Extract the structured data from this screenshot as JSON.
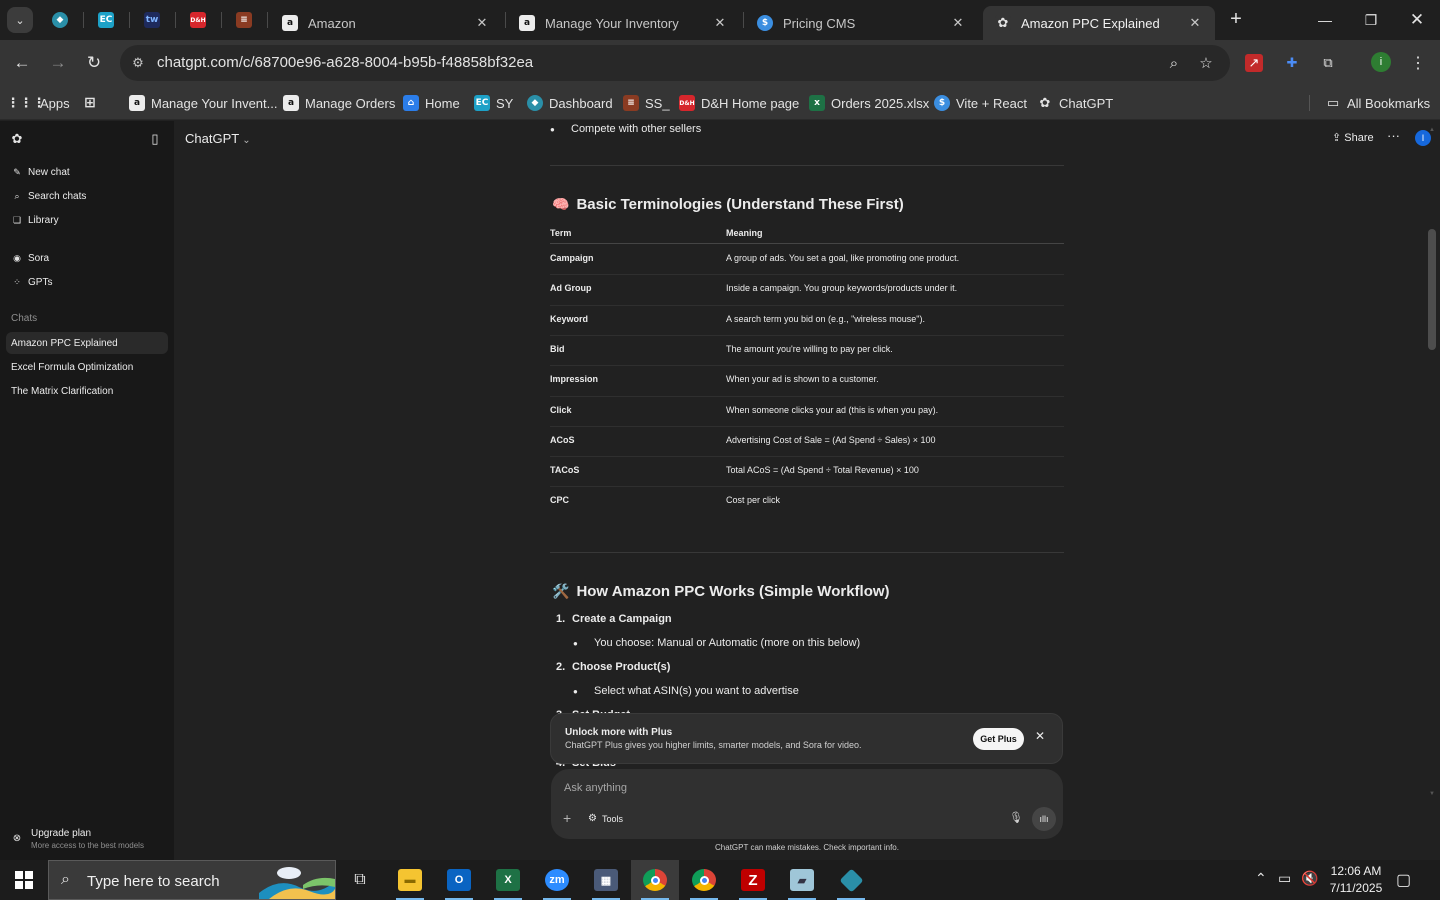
{
  "browser": {
    "tabs": [
      {
        "label": "Amazon",
        "icon": "amazon-icon"
      },
      {
        "label": "Manage Your Inventory",
        "icon": "amazon-icon"
      },
      {
        "label": "Pricing CMS",
        "icon": "dollar-icon"
      },
      {
        "label": "Amazon PPC Explained",
        "icon": "chatgpt-icon",
        "active": true
      }
    ],
    "pinned_tab_icons": [
      "sparkle-icon",
      "ec-icon",
      "tw-icon",
      "dh-icon",
      "stack-icon"
    ],
    "url": "chatgpt.com/c/68700e96-a628-8004-b95b-f48858bf32ea",
    "bookmarks": [
      {
        "label": "Apps",
        "icon": "apps-grid-icon"
      },
      {
        "label": "",
        "icon": "tab-groups-icon"
      },
      {
        "label": "Manage Your Invent...",
        "icon": "amazon-icon"
      },
      {
        "label": "Manage Orders",
        "icon": "amazon-icon"
      },
      {
        "label": "Home",
        "icon": "home-icon"
      },
      {
        "label": "SY",
        "icon": "ec-icon"
      },
      {
        "label": "Dashboard",
        "icon": "sparkle-icon"
      },
      {
        "label": "SS_",
        "icon": "stack-icon"
      },
      {
        "label": "D&H Home page",
        "icon": "dh-icon"
      },
      {
        "label": "Orders 2025.xlsx",
        "icon": "excel-icon"
      },
      {
        "label": "Vite + React",
        "icon": "dollar-icon"
      },
      {
        "label": "ChatGPT",
        "icon": "chatgpt-icon"
      }
    ],
    "all_bookmarks": "All Bookmarks",
    "colors": {
      "tabbar": "#1f1f1f",
      "toolbar": "#353535",
      "omnibox": "#282828"
    }
  },
  "sidebar": {
    "new_chat": "New chat",
    "search_chats": "Search chats",
    "library": "Library",
    "sora": "Sora",
    "gpts": "GPTs",
    "chats_heading": "Chats",
    "chats": [
      "Amazon PPC Explained",
      "Excel Formula Optimization",
      "The Matrix Clarification"
    ],
    "upgrade_title": "Upgrade plan",
    "upgrade_subtitle": "More access to the best models"
  },
  "header": {
    "model": "ChatGPT",
    "share": "Share",
    "avatar_initial": "I"
  },
  "content": {
    "prev_bullet": "Compete with other sellers",
    "section1_emoji": "🧠",
    "section1_title": "Basic Terminologies (Understand These First)",
    "table_headers": [
      "Term",
      "Meaning"
    ],
    "table_rows": [
      [
        "Campaign",
        "A group of ads. You set a goal, like promoting one product."
      ],
      [
        "Ad Group",
        "Inside a campaign. You group keywords/products under it."
      ],
      [
        "Keyword",
        "A search term you bid on (e.g., \"wireless mouse\")."
      ],
      [
        "Bid",
        "The amount you're willing to pay per click."
      ],
      [
        "Impression",
        "When your ad is shown to a customer."
      ],
      [
        "Click",
        "When someone clicks your ad (this is when you pay)."
      ],
      [
        "ACoS",
        "Advertising Cost of Sale = (Ad Spend ÷ Sales) × 100"
      ],
      [
        "TACoS",
        "Total ACoS = (Ad Spend ÷ Total Revenue) × 100"
      ],
      [
        "CPC",
        "Cost per click"
      ]
    ],
    "section2_emoji": "🛠️",
    "section2_title": "How Amazon PPC Works (Simple Workflow)",
    "steps": [
      {
        "n": "1.",
        "title": "Create a Campaign",
        "sub": "You choose: Manual or Automatic (more on this below)"
      },
      {
        "n": "2.",
        "title": "Choose Product(s)",
        "sub": "Select what ASIN(s) you want to advertise"
      },
      {
        "n": "3.",
        "title": "Set Budget"
      },
      {
        "n": "4.",
        "title": "Set Bids"
      }
    ]
  },
  "plus_banner": {
    "title": "Unlock more with Plus",
    "subtitle": "ChatGPT Plus gives you higher limits, smarter models, and Sora for video.",
    "button": "Get Plus"
  },
  "composer": {
    "placeholder": "Ask anything",
    "tools": "Tools"
  },
  "disclaimer": "ChatGPT can make mistakes. Check important info.",
  "taskbar": {
    "search_placeholder": "Type here to search",
    "apps": [
      "task-view-icon",
      "file-explorer-icon",
      "outlook-icon",
      "excel-icon",
      "zoom-icon",
      "calculator-icon",
      "chrome-icon",
      "chrome-icon",
      "filezilla-icon",
      "notes-icon",
      "sparkle-icon"
    ],
    "time": "12:06 AM",
    "date": "7/11/2025"
  }
}
